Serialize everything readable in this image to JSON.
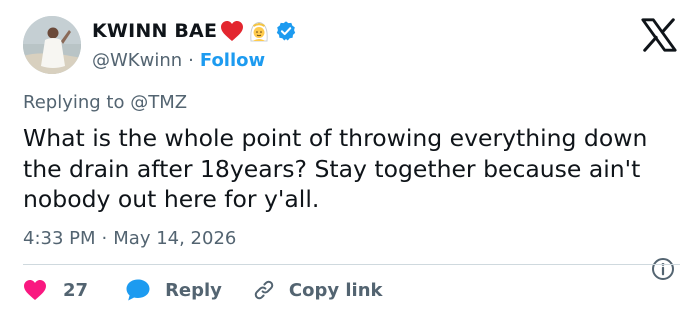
{
  "author": {
    "display_name": "KWINN BAE",
    "handle": "@WKwinn",
    "separator": "·",
    "follow_label": "Follow",
    "emojis": [
      "red-heart-emoji",
      "person-with-veil-emoji"
    ],
    "verified": true
  },
  "reply_context": {
    "prefix": "Replying to",
    "mention": "@TMZ"
  },
  "tweet": {
    "text": "What is the whole point of throwing everything down the drain after 18years? Stay together because ain't nobody out here for y'all."
  },
  "meta": {
    "time": "4:33 PM",
    "separator": "·",
    "date": "May 14, 2026"
  },
  "actions": {
    "like_count": "27",
    "reply_label": "Reply",
    "copy_label": "Copy link"
  },
  "colors": {
    "accent": "#1d9bf0",
    "like": "#f91880",
    "text": "#0f1419",
    "muted": "#536471",
    "divider": "#cfd9de"
  },
  "icons": [
    "x-logo-icon",
    "verified-badge-icon",
    "heart-icon",
    "reply-bubble-icon",
    "link-icon",
    "info-icon"
  ]
}
